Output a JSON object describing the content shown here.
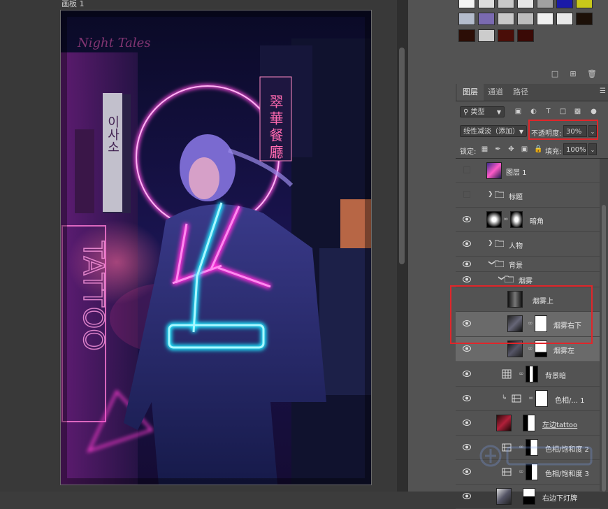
{
  "artboard": {
    "label": "画板 1",
    "image_text": {
      "tattoo_sign": "TATTOO",
      "hanzi_sign": "翠華餐廳",
      "top_sign": "Night Tales",
      "hangul_sign": "이사소"
    }
  },
  "swatches": {
    "colors": [
      "#f3f3f3",
      "#dcdcdc",
      "#c8c8c8",
      "#e6e6e6",
      "#a0a0a0",
      "#1a1aa8",
      "#c8c81a",
      "#b4bccc",
      "#7a6ab0",
      "#c8c8c8",
      "#bcbcbc",
      "#f0f0f0",
      "#e8e8e8",
      "#1c1008",
      "#2c0e06",
      "#cccccc",
      "#4a0e08",
      "#3a0a06"
    ]
  },
  "panel": {
    "tabs": [
      "图层",
      "通道",
      "路径"
    ],
    "active_tab": "图层",
    "kind_filter": "类型",
    "blend_mode": "线性减淡（添加）",
    "opacity_label": "不透明度:",
    "opacity_value": "30%",
    "lock_label": "锁定:",
    "fill_label": "填充:",
    "fill_value": "100%"
  },
  "layers": [
    {
      "name": "图层 1",
      "visible": false
    },
    {
      "name": "标题",
      "visible": false
    },
    {
      "name": "暗角",
      "visible": true
    },
    {
      "name": "人物",
      "visible": true
    },
    {
      "name": "背景",
      "visible": true
    },
    {
      "name": "烟雾",
      "visible": true
    },
    {
      "name": "烟雾上",
      "visible": true
    },
    {
      "name": "烟雾右下",
      "visible": true
    },
    {
      "name": "烟雾左",
      "visible": true
    },
    {
      "name": "背景暗",
      "visible": true
    },
    {
      "name": "色相/... 1",
      "visible": true
    },
    {
      "name": "左边tattoo",
      "visible": true
    },
    {
      "name": "色相/饱和度 2",
      "visible": true
    },
    {
      "name": "色相/饱和度 3",
      "visible": true
    },
    {
      "name": "右边下灯牌",
      "visible": true
    }
  ],
  "colors": {
    "highlight": "#e0262a",
    "panel_bg": "#535353",
    "selected_layer": "#6a6a6a"
  }
}
